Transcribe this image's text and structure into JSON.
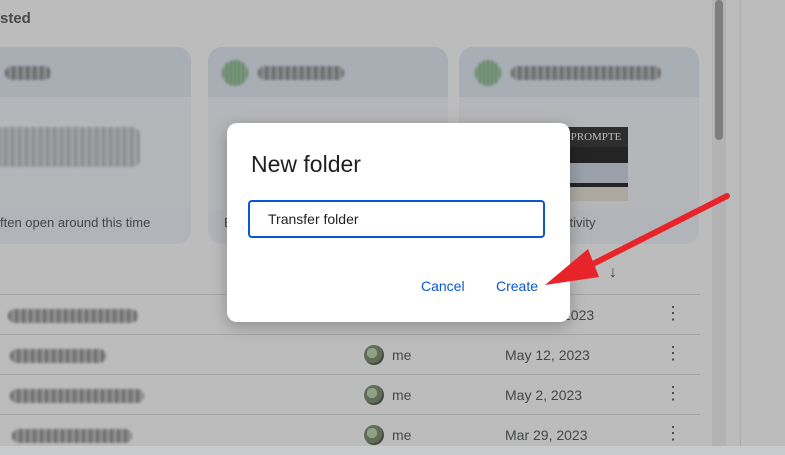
{
  "suggested": {
    "title": "sted",
    "cards": [
      {
        "reason": "ften open around this time"
      },
      {
        "reason": "E"
      },
      {
        "reason": "ctivity",
        "thumb_title": "PROMPTE"
      }
    ]
  },
  "file_list": {
    "sort_icon": "arrow-down-icon",
    "rows": [
      {
        "owner": "",
        "date": "2023"
      },
      {
        "owner": "me",
        "date": "May 12, 2023"
      },
      {
        "owner": "me",
        "date": "May 2, 2023"
      },
      {
        "owner": "me",
        "date": "Mar 29, 2023"
      }
    ],
    "more_icon": "⋮"
  },
  "dialog": {
    "title": "New folder",
    "input_value": "Transfer folder",
    "cancel_label": "Cancel",
    "create_label": "Create"
  },
  "colors": {
    "accent": "#0b57d0",
    "annotation_arrow": "#e8232a"
  }
}
